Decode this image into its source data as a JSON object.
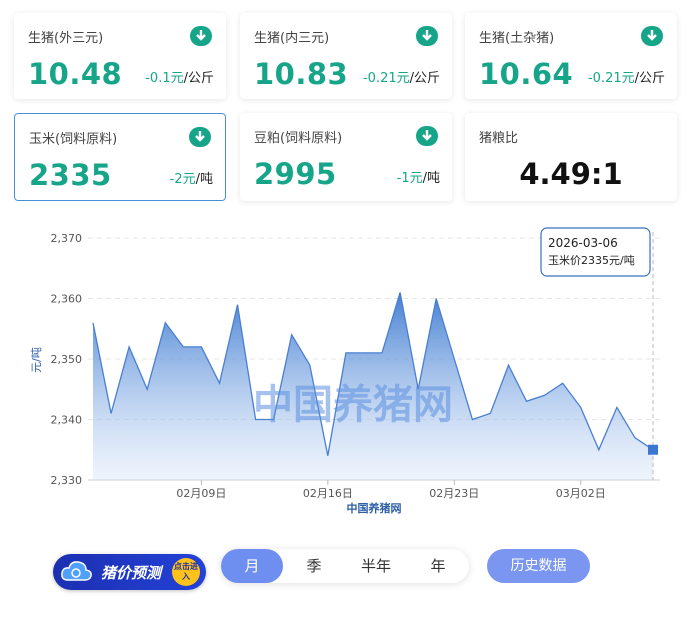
{
  "cards": [
    {
      "label": "生猪(外三元)",
      "value": "10.48",
      "change": "-0.1元",
      "unit": "/公斤"
    },
    {
      "label": "生猪(内三元)",
      "value": "10.83",
      "change": "-0.21元",
      "unit": "/公斤"
    },
    {
      "label": "生猪(土杂猪)",
      "value": "10.64",
      "change": "-0.21元",
      "unit": "/公斤"
    },
    {
      "label": "玉米(饲料原料)",
      "value": "2335",
      "change": "-2元",
      "unit": "/吨"
    },
    {
      "label": "豆粕(饲料原料)",
      "value": "2995",
      "change": "-1元",
      "unit": "/吨"
    },
    {
      "label": "猪粮比",
      "value": "4.49:1"
    }
  ],
  "colors": {
    "up_down_accent": "#17a589",
    "chart_line": "#4a7fd0",
    "active_tab": "#6f8ff0"
  },
  "chart_data": {
    "type": "area",
    "ylabel": "元/吨",
    "xlabel": "中国养猪网",
    "watermark": "中国养猪网",
    "ylim": [
      2330,
      2370
    ],
    "y_ticks": [
      "2,330",
      "2,340",
      "2,350",
      "2,360",
      "2,370"
    ],
    "x_ticks": [
      "02月09日",
      "02月16日",
      "02月23日",
      "03月02日"
    ],
    "tooltip": {
      "date": "2026-03-06",
      "text": "玉米价2335元/吨"
    },
    "series": [
      {
        "name": "玉米价",
        "values": [
          2356,
          2341,
          2352,
          2345,
          2356,
          2352,
          2352,
          2346,
          2359,
          2340,
          2340,
          2354,
          2349,
          2334,
          2351,
          2351,
          2351,
          2361,
          2345,
          2360,
          2350,
          2340,
          2341,
          2349,
          2343,
          2344,
          2346,
          2342,
          2335,
          2342,
          2337,
          2335
        ]
      }
    ],
    "grid": true
  },
  "icons": {
    "download": "download-arrow-icon",
    "cloud": "cloud-icon"
  },
  "tabs": [
    "月",
    "季",
    "半年",
    "年"
  ],
  "active_tab": "月",
  "history_button": "历史数据",
  "predict_button": "猪价预测",
  "predict_badge": "点击进入"
}
